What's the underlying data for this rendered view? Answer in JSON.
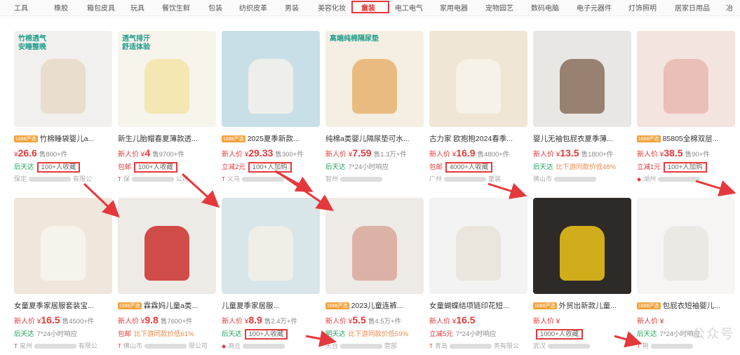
{
  "categories": [
    {
      "label": "工具"
    },
    {
      "label": "橡胶"
    },
    {
      "label": "箱包皮具"
    },
    {
      "label": "玩具"
    },
    {
      "label": "餐饮生鲜"
    },
    {
      "label": "包装"
    },
    {
      "label": "纺织皮革"
    },
    {
      "label": "男装"
    },
    {
      "label": "美容化妆"
    },
    {
      "label": "童装"
    },
    {
      "label": "电工电气"
    },
    {
      "label": "家用电器"
    },
    {
      "label": "宠物园艺"
    },
    {
      "label": "数码电脑"
    },
    {
      "label": "电子元器件"
    },
    {
      "label": "灯饰照明"
    },
    {
      "label": "居家日用品"
    },
    {
      "label": "冶"
    }
  ],
  "active_category": "童装",
  "products": [
    {
      "badge": "1688严选",
      "title": "竹棉睡袋婴儿a...",
      "price_tag": "¥",
      "price": "26.6",
      "sold": "售800+件",
      "ship": "后天达",
      "ship_red": false,
      "ship_value": "100+人收藏",
      "ship_boxed": true,
      "ship_orange": false,
      "shop_prefix": "保定",
      "shop_suffix": "有限公",
      "shop_icon": "",
      "img_tag": "竹棉透气\n安睡整晚",
      "img_colors": [
        "#f2f0ee",
        "#e7d9c8"
      ]
    },
    {
      "badge": "",
      "title": "新生儿胎帽春夏薄款透...",
      "price_tag": "新人价 ¥",
      "price": "4",
      "sold": "售9700+件",
      "ship": "包邮",
      "ship_red": true,
      "ship_value": "100+人收藏",
      "ship_boxed": true,
      "ship_orange": false,
      "shop_prefix": "保",
      "shop_suffix": "公司",
      "shop_icon": "T",
      "img_tag": "透气排汗\n舒适体验",
      "img_colors": [
        "#f7f4ec",
        "#f3e4a8"
      ]
    },
    {
      "badge": "1688严选",
      "title": "2025夏季新款...",
      "price_tag": "新人价 ¥",
      "price": "29.33",
      "sold": "售300+件",
      "ship": "立减2元",
      "ship_red": true,
      "ship_value": "100+人加购",
      "ship_boxed": true,
      "ship_orange": false,
      "shop_prefix": "义乌",
      "shop_suffix": "",
      "shop_icon": "T",
      "img_tag": "",
      "img_colors": [
        "#c9dfe8",
        "#f5f1ea"
      ]
    },
    {
      "badge": "",
      "title": "纯棉a类婴儿隔尿垫可水...",
      "price_tag": "新人价 ¥",
      "price": "7.59",
      "sold": "售1.3万+件",
      "ship": "后天达",
      "ship_red": false,
      "ship_value": "7*24小时响应",
      "ship_boxed": false,
      "ship_orange": false,
      "shop_prefix": "智州",
      "shop_suffix": "",
      "shop_icon": "",
      "img_tag": "高端纯棉隔尿垫",
      "img_colors": [
        "#f5efe3",
        "#e8b26e"
      ]
    },
    {
      "badge": "",
      "title": "古力家 欧抱抱2024春季...",
      "price_tag": "新人价 ¥",
      "price": "16.9",
      "sold": "售4800+件",
      "ship": "包邮",
      "ship_red": true,
      "ship_value": "4000+人收藏",
      "ship_boxed": true,
      "ship_orange": false,
      "shop_prefix": "广州",
      "shop_suffix": "童装",
      "shop_icon": "",
      "img_tag": "",
      "img_colors": [
        "#efe6d6",
        "#f7f3ea"
      ]
    },
    {
      "badge": "",
      "title": "婴儿无袖包屁衣夏季薄...",
      "price_tag": "新人价 ¥",
      "price": "13.5",
      "sold": "售1800+件",
      "ship": "后天达",
      "ship_red": false,
      "ship_value": "比下游同款价低48%",
      "ship_boxed": false,
      "ship_orange": true,
      "shop_prefix": "佛山市",
      "shop_suffix": "",
      "shop_icon": "",
      "img_tag": "",
      "img_colors": [
        "#e9e7e4",
        "#8a6f5c"
      ]
    },
    {
      "badge": "1688严选",
      "title": "85805全棉双层...",
      "price_tag": "新人价 ¥",
      "price": "38.5",
      "sold": "售90+件",
      "ship": "立减1元",
      "ship_red": true,
      "ship_value": "100+人加购",
      "ship_boxed": true,
      "ship_orange": false,
      "shop_prefix": "湖州",
      "shop_suffix": "",
      "shop_icon": "◆",
      "img_tag": "",
      "img_colors": [
        "#f4e4e0",
        "#e8b8b0"
      ]
    },
    {
      "badge": "",
      "title": "女童夏季家居服套装宝...",
      "price_tag": "新人价 ¥",
      "price": "16.5",
      "sold": "售4500+件",
      "ship": "后天达",
      "ship_red": false,
      "ship_value": "7*24小时响应",
      "ship_boxed": false,
      "ship_orange": false,
      "shop_prefix": "泉州",
      "shop_suffix": "有限公",
      "shop_icon": "T",
      "img_tag": "",
      "img_colors": [
        "#efe7dc",
        "#f7f5f0"
      ]
    },
    {
      "badge": "1688严选",
      "title": "霖霖妈儿童a类...",
      "price_tag": "新人价 ¥",
      "price": "9.8",
      "sold": "售7600+件",
      "ship": "包邮",
      "ship_red": true,
      "ship_value": "比下游同款价低61%",
      "ship_boxed": false,
      "ship_orange": true,
      "shop_prefix": "佛山市",
      "shop_suffix": "限公司",
      "shop_icon": "T",
      "img_tag": "",
      "img_colors": [
        "#eeeae6",
        "#c9302c"
      ]
    },
    {
      "badge": "",
      "title": "儿童夏季家居服...",
      "price_tag": "新人价 ¥",
      "price": "8.9",
      "sold": "售2.4万+件",
      "ship": "后天达",
      "ship_red": false,
      "ship_value": "100+人收藏",
      "ship_boxed": true,
      "ship_orange": false,
      "shop_prefix": "商丘",
      "shop_suffix": "",
      "shop_icon": "◆",
      "img_tag": "",
      "img_colors": [
        "#d8e6ea",
        "#f4f0e6"
      ]
    },
    {
      "badge": "1688严选",
      "title": "2023儿童连裤...",
      "price_tag": "新人价 ¥",
      "price": "5.5",
      "sold": "售4.5万+件",
      "ship": "明天达",
      "ship_red": false,
      "ship_value": "比下游同款价低59%",
      "ship_boxed": false,
      "ship_orange": true,
      "shop_prefix": "天台",
      "shop_suffix": "营部",
      "shop_icon": "",
      "img_tag": "",
      "img_colors": [
        "#eeeae6",
        "#d9a89a"
      ]
    },
    {
      "badge": "",
      "title": "女童蝴蝶结项链印花短...",
      "price_tag": "新人价 ¥",
      "price": "16.5",
      "sold": "",
      "ship": "立减5元",
      "ship_red": true,
      "ship_value": "7*24小时响应",
      "ship_boxed": false,
      "ship_orange": false,
      "shop_prefix": "青岛",
      "shop_suffix": "务有限公",
      "shop_icon": "T",
      "img_tag": "",
      "img_colors": [
        "#f3f3f3",
        "#e9e3d8"
      ]
    },
    {
      "badge": "1688严选",
      "title": "外贸出新款儿童...",
      "price_tag": "新人价 ¥",
      "price": "",
      "sold": "",
      "ship": "",
      "ship_red": false,
      "ship_value": "1000+人收藏",
      "ship_boxed": true,
      "ship_orange": false,
      "shop_prefix": "武汉",
      "shop_suffix": "",
      "shop_icon": "",
      "img_tag": "",
      "img_colors": [
        "#2d2a28",
        "#f0c419"
      ]
    },
    {
      "badge": "1688严选",
      "title": "包屁衣短袖婴儿...",
      "price_tag": "新人价 ¥",
      "price": "",
      "sold": "",
      "ship": "后天达",
      "ship_red": false,
      "ship_value": "7*24小时响应",
      "ship_boxed": false,
      "ship_orange": false,
      "shop_prefix": "荆",
      "shop_suffix": "",
      "shop_icon": "T",
      "img_tag": "",
      "img_colors": [
        "#f7f5f3",
        "#eae6e0"
      ]
    }
  ],
  "watermark": "公众号"
}
